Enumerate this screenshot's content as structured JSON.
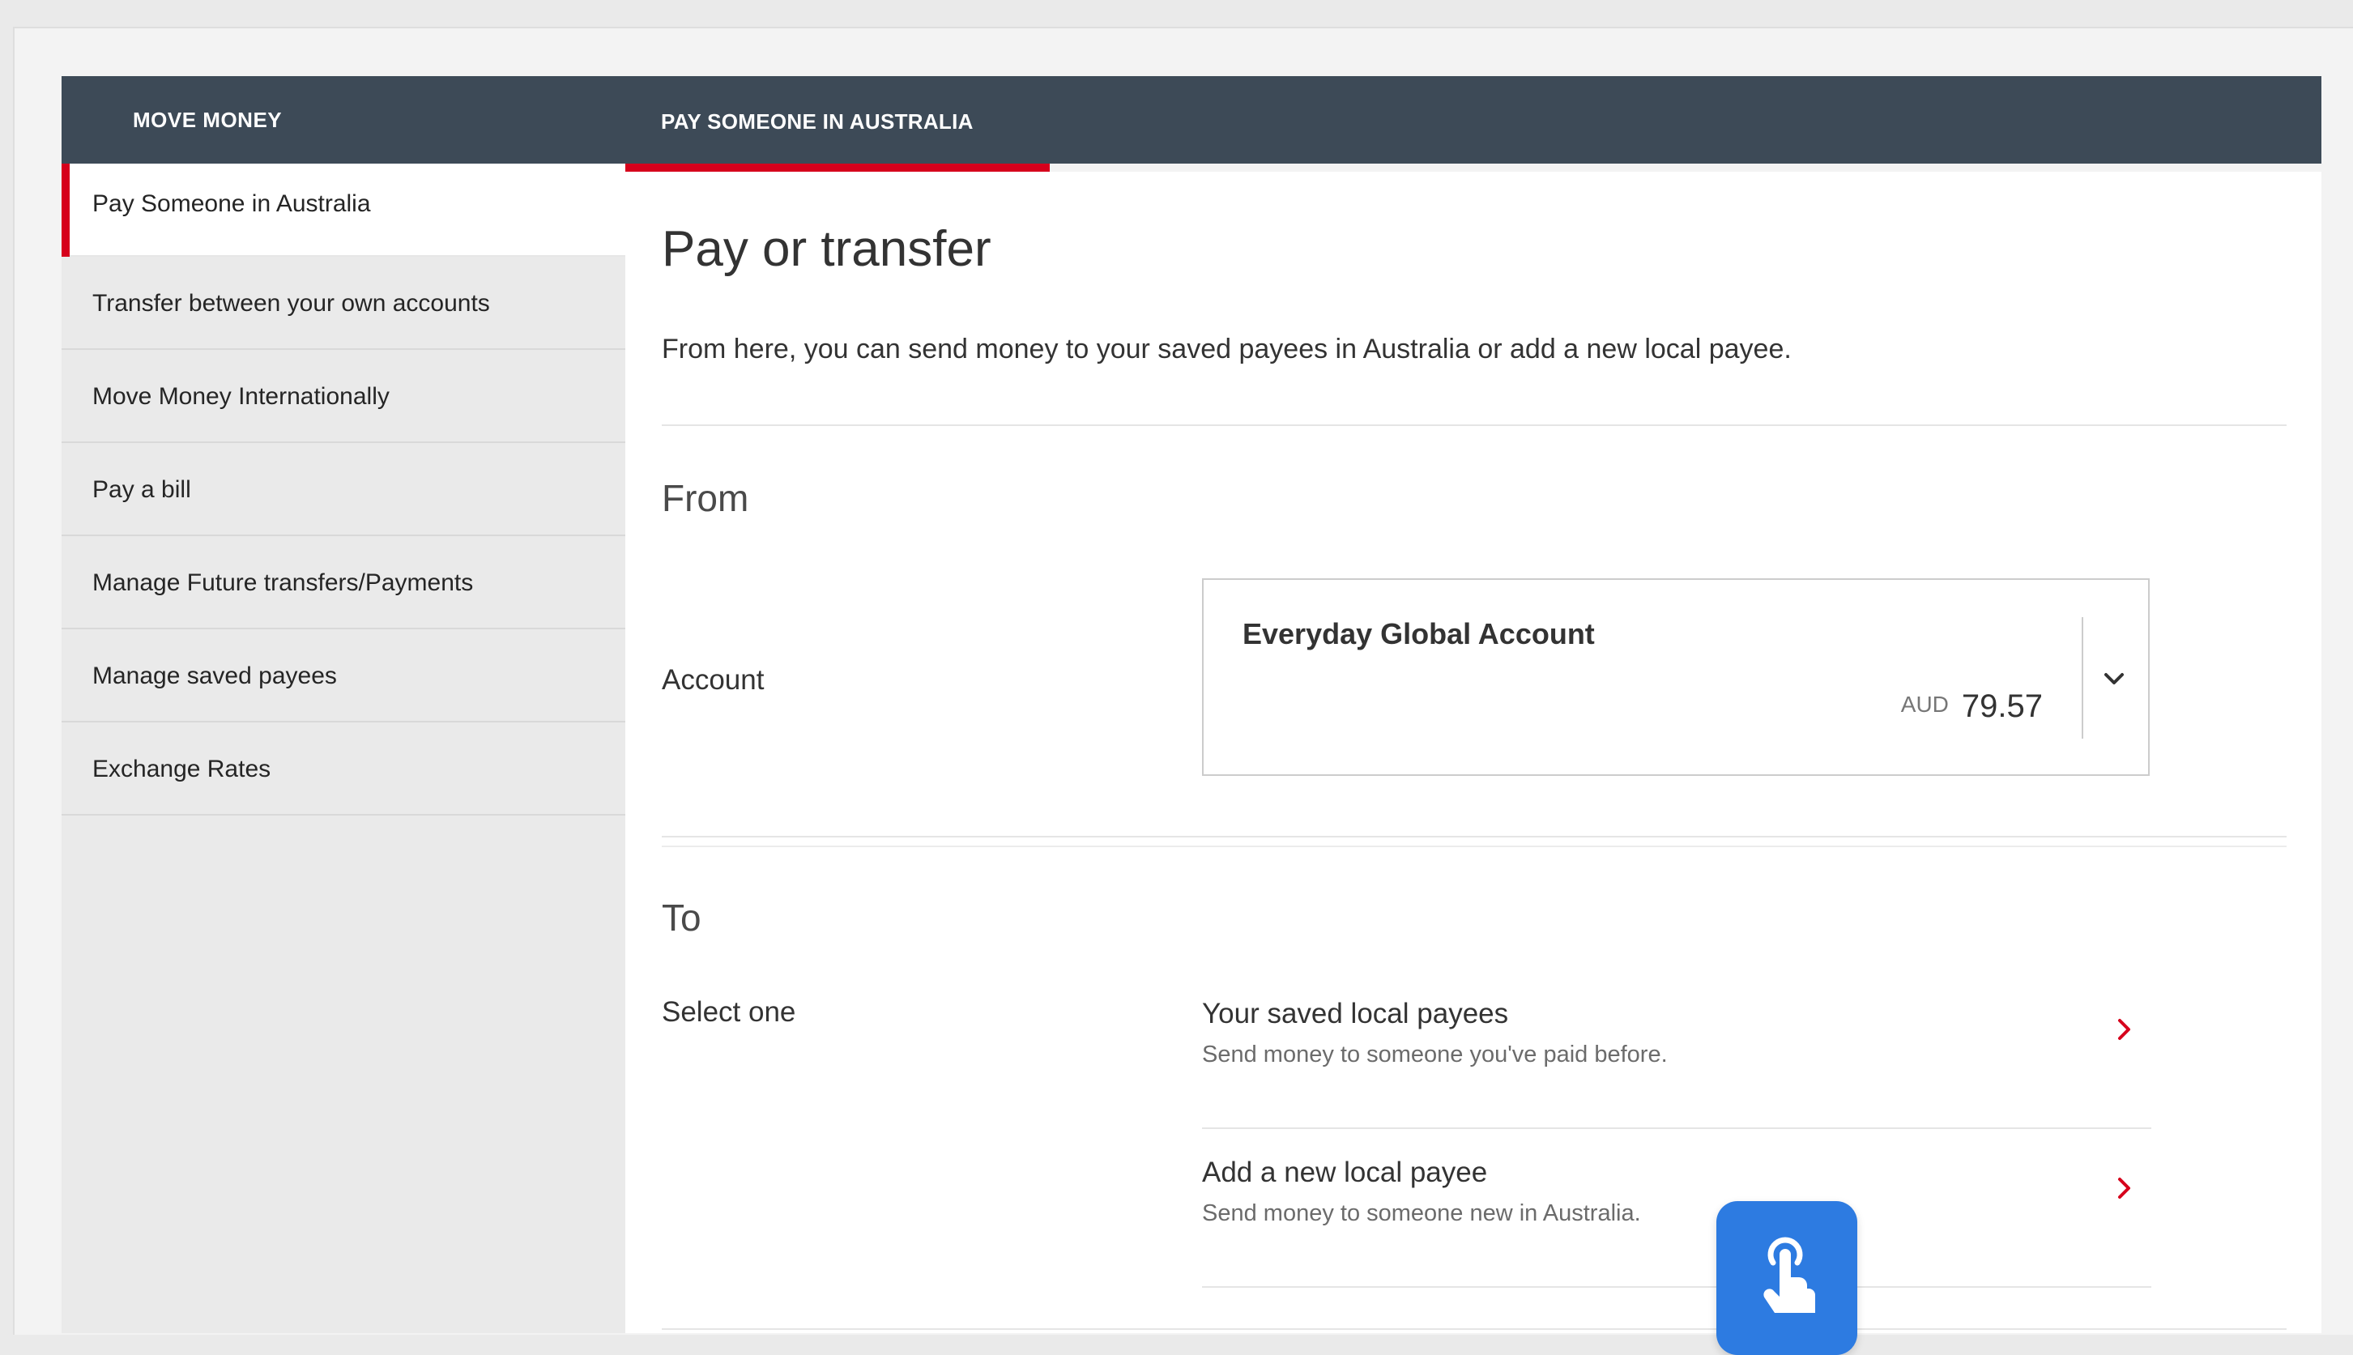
{
  "nav": {
    "section_title": "MOVE MONEY",
    "active_tab": "PAY SOMEONE IN AUSTRALIA",
    "accent_color": "#d6001c",
    "header_color": "#3d4a57"
  },
  "sidebar": {
    "items": [
      {
        "label": "Pay Someone in Australia",
        "active": true
      },
      {
        "label": "Transfer between your own accounts",
        "active": false
      },
      {
        "label": "Move Money Internationally",
        "active": false
      },
      {
        "label": "Pay a bill",
        "active": false
      },
      {
        "label": "Manage Future transfers/Payments",
        "active": false
      },
      {
        "label": "Manage saved payees",
        "active": false
      },
      {
        "label": "Exchange Rates",
        "active": false
      }
    ]
  },
  "main": {
    "title": "Pay or transfer",
    "intro": "From here, you can send money to your saved payees in Australia or add a new local payee.",
    "from": {
      "heading": "From",
      "account_label": "Account",
      "account": {
        "name": "Everyday Global Account",
        "currency": "AUD",
        "balance": "79.57",
        "icon": "chevron-down-icon"
      }
    },
    "to": {
      "heading": "To",
      "select_label": "Select one",
      "options": [
        {
          "title": "Your saved local payees",
          "description": "Send money to someone you've paid before.",
          "icon": "chevron-right-icon"
        },
        {
          "title": "Add a new local payee",
          "description": "Send money to someone new in Australia.",
          "icon": "chevron-right-icon"
        }
      ]
    }
  },
  "overlay": {
    "icon": "touch-hand-icon",
    "color": "#2d7be1"
  }
}
